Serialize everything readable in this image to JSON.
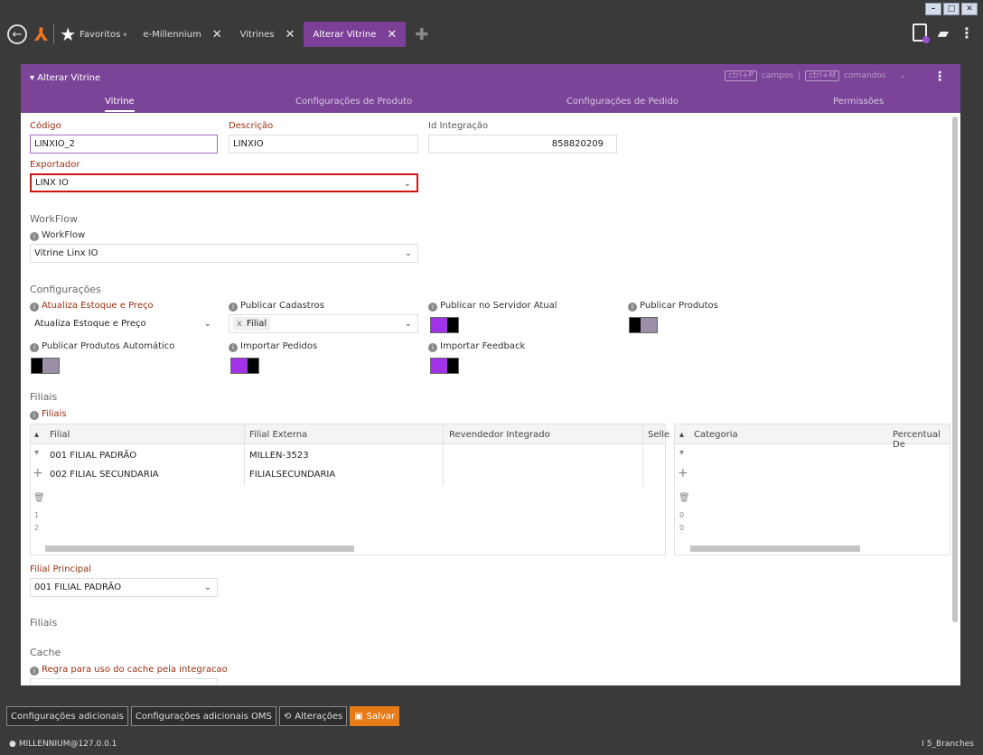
{
  "window": {
    "min": "–",
    "max": "□",
    "close": "✕"
  },
  "nav": {
    "favorites": "Favoritos",
    "tabs": [
      {
        "label": "e-Millennium"
      },
      {
        "label": "Vitrines"
      },
      {
        "label": "Alterar Vitrine"
      }
    ]
  },
  "header": {
    "title": "Alterar Vitrine",
    "kbd_fields": "ctrl+P",
    "fields": "campos",
    "kbd_cmds": "ctrl+M",
    "cmds": "comandos",
    "tabs": [
      "Vitrine",
      "Configurações de Produto",
      "Configurações de Pedido",
      "Permissões"
    ]
  },
  "form": {
    "codigo": {
      "label": "Código",
      "value": "LINXIO_2"
    },
    "descricao": {
      "label": "Descrição",
      "value": "LINXIO"
    },
    "id_integracao": {
      "label": "Id Integração",
      "value": "858820209"
    },
    "exportador": {
      "label": "Exportador",
      "value": "LINX IO"
    },
    "workflow_section": "WorkFlow",
    "workflow": {
      "label": "WorkFlow",
      "value": "Vitrine Linx IO"
    },
    "config_section": "Configurações",
    "atualiza": {
      "label": "Atualiza Estoque e Preço",
      "value": "Atualiza Estoque e Preço"
    },
    "publicar_cadastros": {
      "label": "Publicar Cadastros",
      "tag": "Filial"
    },
    "publicar_servidor": {
      "label": "Publicar no Servidor Atual",
      "on": true
    },
    "publicar_produtos": {
      "label": "Publicar Produtos",
      "on": false
    },
    "publicar_auto": {
      "label": "Publicar Produtos Automático",
      "on": false
    },
    "importar_pedidos": {
      "label": "Importar Pedidos",
      "on": true
    },
    "importar_feedback": {
      "label": "Importar Feedback",
      "on": true
    },
    "filiais_section": "Filiais",
    "filiais_label": "Filiais",
    "grid_left": {
      "cols": [
        "Filial",
        "Filial Externa",
        "Revendedor Integrado",
        "Selle"
      ],
      "rows": [
        [
          "001 FILIAL PADRÃO",
          "MILLEN-3523",
          "",
          ""
        ],
        [
          "002 FILIAL SECUNDARIA",
          "FILIALSECUNDARIA",
          "",
          ""
        ]
      ],
      "pager": [
        "1",
        "2"
      ]
    },
    "grid_right": {
      "cols": [
        "Categoria",
        "Percentual De"
      ],
      "pager": [
        "0",
        "0"
      ]
    },
    "filial_principal": {
      "label": "Filial Principal",
      "value": "001 FILIAL PADRÃO"
    },
    "filiais2_section": "Filiais",
    "cache_section": "Cache",
    "cache_label": "Regra para uso do cache pela integracao"
  },
  "toolbar": {
    "b1": "Configurações adicionais",
    "b2": "Configurações adicionais OMS",
    "b3": "Alterações",
    "b4": "Salvar"
  },
  "status": {
    "left": "MILLENNIUM@127.0.0.1",
    "right": "5_Branches"
  }
}
